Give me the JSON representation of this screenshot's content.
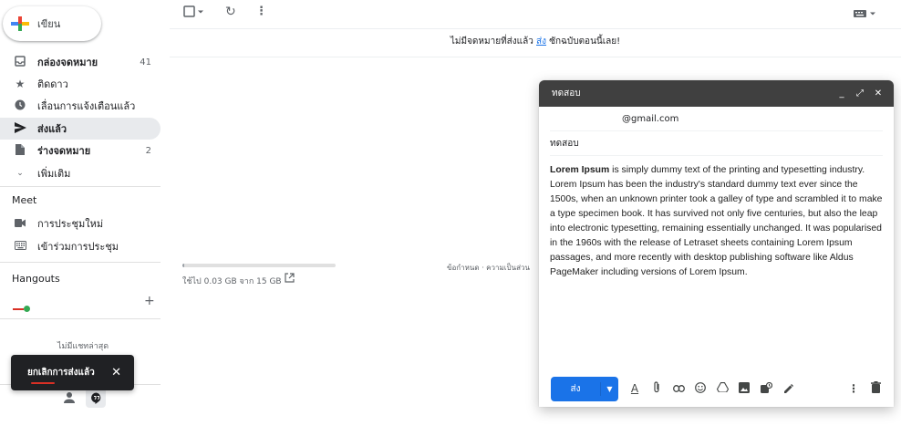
{
  "compose_button": {
    "label": "เขียน"
  },
  "nav": [
    {
      "label": "กล่องจดหมาย",
      "count": "41",
      "bold": true,
      "icon": "inbox-icon"
    },
    {
      "label": "ติดดาว",
      "count": "",
      "bold": false,
      "icon": "star-icon"
    },
    {
      "label": "เลื่อนการแจ้งเตือนแล้ว",
      "count": "",
      "bold": false,
      "icon": "clock-icon"
    },
    {
      "label": "ส่งแล้ว",
      "count": "",
      "bold": true,
      "icon": "send-icon"
    },
    {
      "label": "ร่างจดหมาย",
      "count": "2",
      "bold": true,
      "icon": "draft-icon"
    },
    {
      "label": "เพิ่มเติม",
      "count": "",
      "bold": false,
      "icon": "chevron-down-icon"
    }
  ],
  "meet": {
    "title": "Meet",
    "items": [
      {
        "label": "การประชุมใหม่",
        "icon": "video-icon"
      },
      {
        "label": "เข้าร่วมการประชุม",
        "icon": "keyboard-icon"
      }
    ]
  },
  "hangouts": {
    "title": "Hangouts",
    "add_symbol": "+",
    "no_chats": "ไม่มีแชทล่าสุด"
  },
  "snackbar": {
    "message": "ยกเลิกการส่งแล้ว",
    "close_symbol": "✕"
  },
  "main": {
    "notice_prefix": "ไม่มีจดหมายที่ส่งแล้ว",
    "notice_link": "ส่ง",
    "notice_suffix": "ซักฉบับตอนนี้เลย!",
    "storage_text": "ใช้ไป 0.03 GB จาก 15 GB",
    "storage_fraction": 0.002,
    "footer": "ข้อกำหนด · ความเป็นส่วน"
  },
  "compose": {
    "title": "ทดสอบ",
    "to": "@gmail.com",
    "subject": "ทดสอบ",
    "body_bold": "Lorem Ipsum",
    "body_rest": " is simply dummy text of the printing and typesetting industry. Lorem Ipsum has been the industry's standard dummy text ever since the 1500s, when an unknown printer took a galley of type and scrambled it to make a type specimen book. It has survived not only five centuries, but also the leap into electronic typesetting, remaining essentially unchanged. It was popularised in the 1960s with the release of Letraset sheets containing Lorem Ipsum passages, and more recently with desktop publishing software like Aldus PageMaker including versions of Lorem Ipsum.",
    "send_label": "ส่ง"
  },
  "colors": {
    "accent": "#1a73e8",
    "active_nav": "#e8eaed",
    "compose_header": "#404040",
    "snackbar": "#202124"
  }
}
